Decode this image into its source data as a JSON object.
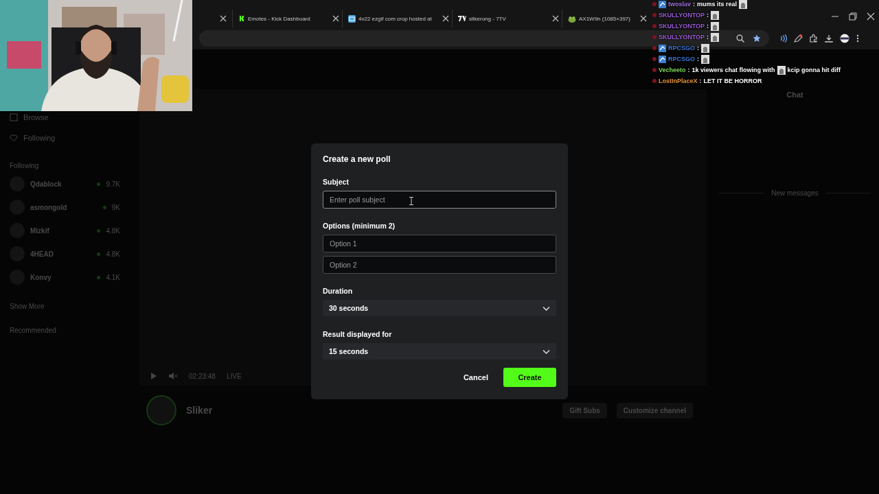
{
  "browser": {
    "tabs": [
      {
        "title": "Emotes - Kick Dashboard",
        "kind": "kick"
      },
      {
        "title": "4x22 ezgif com crop hosted at",
        "kind": "ibb"
      },
      {
        "title": "slikerong - 7TV",
        "kind": "seven"
      },
      {
        "title": "AX1W9n (1085×397)",
        "kind": "frog"
      }
    ]
  },
  "site": {
    "nav": [
      "Browse",
      "Following"
    ],
    "following_title": "Following",
    "following": [
      {
        "name": "Qdablock",
        "viewers": "9.7K"
      },
      {
        "name": "asmongold",
        "viewers": "9K"
      },
      {
        "name": "Mizkif",
        "viewers": "4.8K"
      },
      {
        "name": "4HEAD",
        "viewers": "4.8K"
      },
      {
        "name": "Konvy",
        "viewers": "4.1K"
      }
    ],
    "show_more": "Show More",
    "recommended_title": "Recommended",
    "player": {
      "time": "02:23:48",
      "live": "LIVE"
    },
    "channel": {
      "name": "Sliker",
      "actions": [
        "Gift Subs",
        "Customize channel"
      ]
    },
    "chat": {
      "title": "Chat",
      "divider": "New messages"
    }
  },
  "overlay_chat": [
    {
      "user": "twoslav",
      "sep": ":",
      "color": "#a070e0",
      "badge": true,
      "parts": [
        {
          "kind": "text",
          "text": "mums its real"
        },
        {
          "kind": "emote"
        }
      ]
    },
    {
      "user": "SKULLYONTOP",
      "sep": ":",
      "color": "#9b5bd8",
      "badge": false,
      "parts": [
        {
          "kind": "emote"
        }
      ]
    },
    {
      "user": "SKULLYONTOP",
      "sep": ":",
      "color": "#9b5bd8",
      "badge": false,
      "parts": [
        {
          "kind": "emote"
        }
      ]
    },
    {
      "user": "SKULLYONTOP",
      "sep": ":",
      "color": "#9b5bd8",
      "badge": false,
      "parts": [
        {
          "kind": "emote"
        }
      ]
    },
    {
      "user": "RPCSGO",
      "sep": ":",
      "color": "#3a74d6",
      "badge": true,
      "parts": [
        {
          "kind": "emote"
        }
      ]
    },
    {
      "user": "RPCSGO",
      "sep": ":",
      "color": "#3a74d6",
      "badge": true,
      "parts": [
        {
          "kind": "emote"
        }
      ]
    },
    {
      "user": "Vecheeto",
      "sep": ":",
      "color": "#7ed957",
      "badge": false,
      "parts": [
        {
          "kind": "text",
          "text": "1k viewers chat flowing with"
        },
        {
          "kind": "emote"
        },
        {
          "kind": "text",
          "text": "kcip gonna hit diff"
        }
      ]
    },
    {
      "user": "LostInPlaceX",
      "sep": ":",
      "color": "#e6923a",
      "badge": false,
      "parts": [
        {
          "kind": "text",
          "text": "LET IT BE HORROR"
        }
      ]
    }
  ],
  "poll": {
    "title": "Create a new poll",
    "subject": {
      "label": "Subject",
      "placeholder": "Enter poll subject",
      "focused": true
    },
    "options_label": "Options (minimum 2)",
    "options": [
      {
        "placeholder": "Option 1"
      },
      {
        "placeholder": "Option 2"
      }
    ],
    "duration": {
      "label": "Duration",
      "value": "30 seconds"
    },
    "result": {
      "label": "Result displayed for",
      "value": "15 seconds"
    },
    "buttons": [
      {
        "label": "Cancel",
        "kind": "secondary"
      },
      {
        "label": "Create",
        "kind": "primary"
      }
    ]
  }
}
